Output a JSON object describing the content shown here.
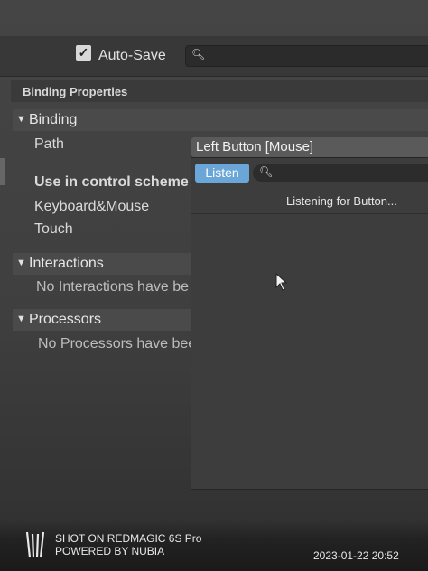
{
  "toolbar": {
    "autosave_checked": "✓",
    "autosave_label": "Auto-Save",
    "search_icon": "search-icon"
  },
  "panel": {
    "title": "Binding Properties",
    "binding": {
      "header": "Binding",
      "path_label": "Path",
      "path_value": "Left Button [Mouse]",
      "scheme_label": "Use in control scheme",
      "schemes": [
        "Keyboard&Mouse",
        "Touch"
      ]
    },
    "interactions": {
      "header": "Interactions",
      "empty_text": "No Interactions have be"
    },
    "processors": {
      "header": "Processors",
      "empty_text": "No Processors have bee"
    }
  },
  "popup": {
    "listen_label": "Listen",
    "status_text": "Listening for Button..."
  },
  "watermark": {
    "line1": "SHOT ON REDMAGIC 6S Pro",
    "line2": "POWERED BY NUBIA",
    "datetime": "2023-01-22  20:52"
  },
  "colors": {
    "listen_accent": "#6aa6d8",
    "panel_bg": "#3f3f3f"
  }
}
